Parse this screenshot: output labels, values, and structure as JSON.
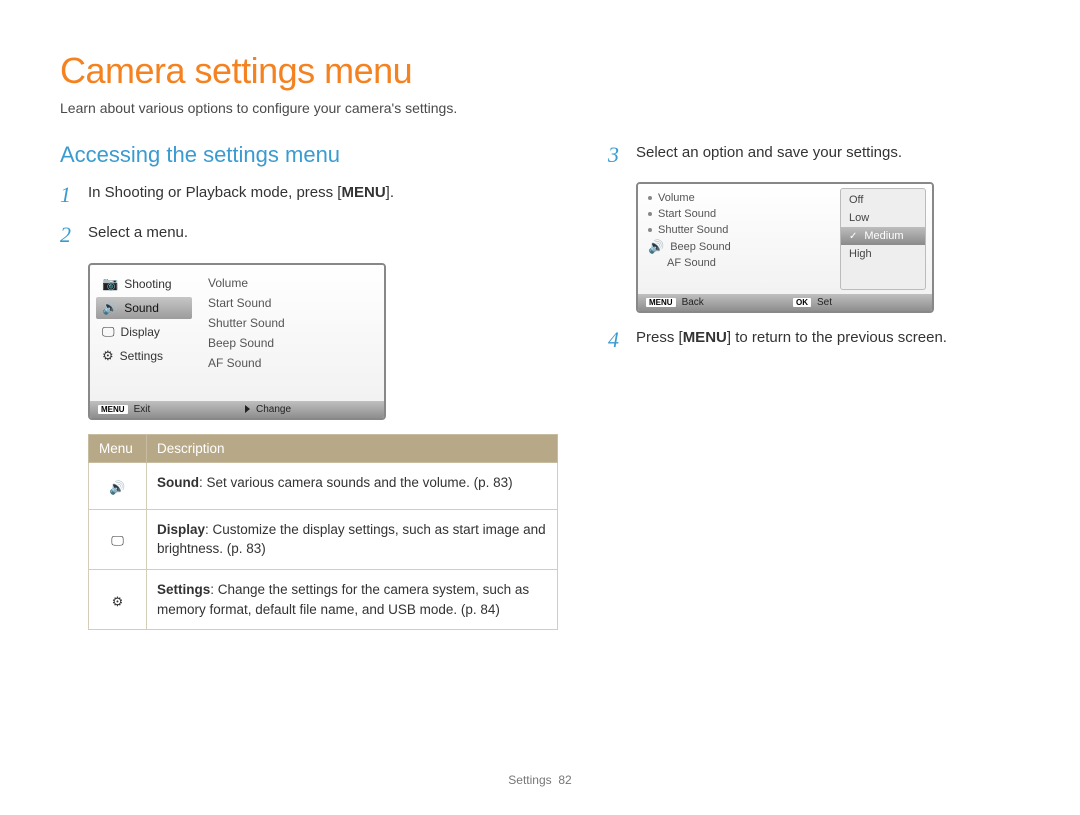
{
  "page": {
    "title": "Camera settings menu",
    "subtitle": "Learn about various options to configure your camera's settings.",
    "sectionHeading": "Accessing the settings menu",
    "footerLabel": "Settings",
    "footerPage": "82"
  },
  "steps": {
    "s1": {
      "num": "1",
      "pre": "In Shooting or Playback mode, press [",
      "bold": "MENU",
      "post": "]."
    },
    "s2": {
      "num": "2",
      "text": "Select a menu."
    },
    "s3": {
      "num": "3",
      "text": "Select an option and save your settings."
    },
    "s4": {
      "num": "4",
      "pre": "Press [",
      "bold": "MENU",
      "post": "] to return to the previous screen."
    }
  },
  "screen1": {
    "left": {
      "items": [
        {
          "label": "Shooting"
        },
        {
          "label": "Sound"
        },
        {
          "label": "Display"
        },
        {
          "label": "Settings"
        }
      ],
      "selectedIndex": 1
    },
    "right": [
      "Volume",
      "Start Sound",
      "Shutter Sound",
      "Beep Sound",
      "AF Sound"
    ],
    "footer": {
      "leftBadge": "MENU",
      "leftText": "Exit",
      "rightText": "Change"
    }
  },
  "screen2": {
    "left": [
      {
        "label": "Volume"
      },
      {
        "label": "Start Sound"
      },
      {
        "label": "Shutter Sound"
      },
      {
        "label": "Beep Sound"
      },
      {
        "label": "AF Sound"
      }
    ],
    "options": [
      "Off",
      "Low",
      "Medium",
      "High"
    ],
    "selectedOption": 2,
    "footer": {
      "leftBadge": "MENU",
      "leftText": "Back",
      "rightBadge": "OK",
      "rightText": "Set"
    }
  },
  "table": {
    "head": {
      "col1": "Menu",
      "col2": "Description"
    },
    "rows": [
      {
        "bold": "Sound",
        "rest": ": Set various camera sounds and the volume. (p. 83)"
      },
      {
        "bold": "Display",
        "rest": ": Customize the display settings, such as start image and brightness. (p. 83)"
      },
      {
        "bold": "Settings",
        "rest": ": Change the settings for the camera system, such as memory format, default file name, and USB mode. (p. 84)"
      }
    ]
  }
}
